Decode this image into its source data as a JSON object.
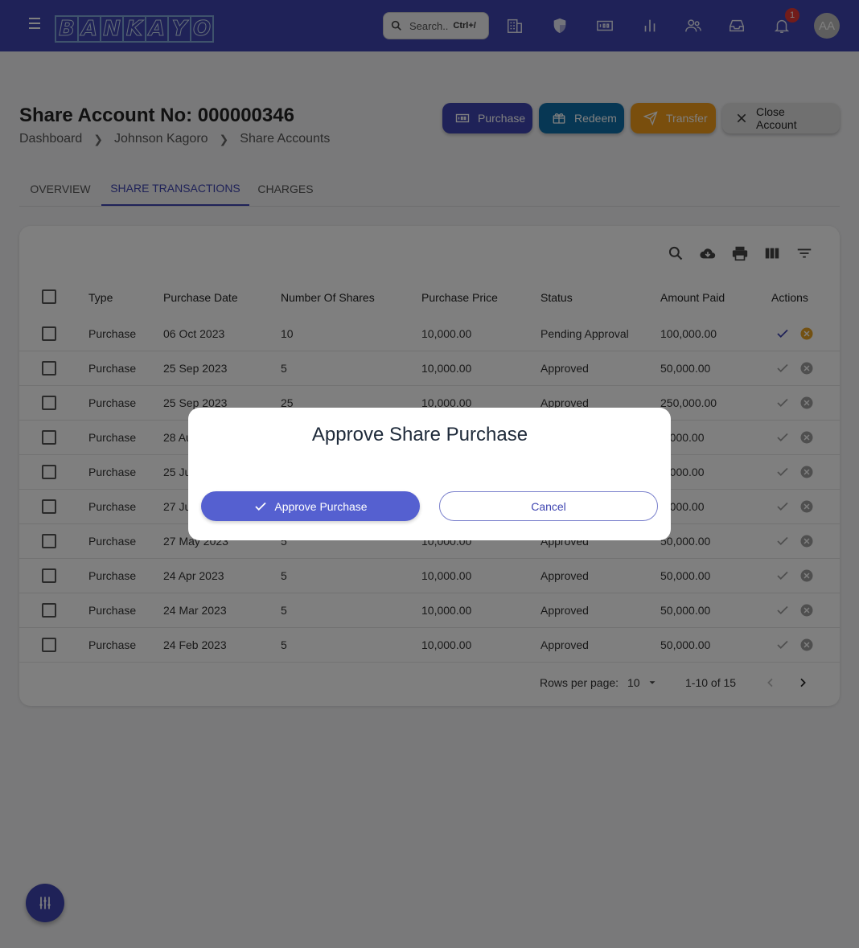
{
  "topbar": {
    "logo_letters": [
      "B",
      "A",
      "N",
      "K",
      "A",
      "Y",
      "O"
    ],
    "search_placeholder": "Search..",
    "search_shortcut": "Ctrl+/",
    "icons": [
      "building-icon",
      "shield-icon",
      "money-icon",
      "bar-chart-icon",
      "users-icon",
      "inbox-icon",
      "bell-icon"
    ],
    "notification_count": "1",
    "avatar_initials": "AA"
  },
  "header": {
    "title": "Share Account No: 000000346",
    "breadcrumb": [
      "Dashboard",
      "Johnson Kagoro",
      "Share Accounts"
    ],
    "actions": {
      "purchase": "Purchase",
      "redeem": "Redeem",
      "transfer": "Transfer",
      "close": "Close Account"
    }
  },
  "tabs": [
    "OVERVIEW",
    "SHARE TRANSACTIONS",
    "CHARGES"
  ],
  "active_tab": "SHARE TRANSACTIONS",
  "table": {
    "columns": [
      "Type",
      "Purchase Date",
      "Number Of Shares",
      "Purchase Price",
      "Status",
      "Amount Paid",
      "Actions"
    ],
    "rows": [
      {
        "type": "Purchase",
        "date": "06 Oct 2023",
        "shares": "10",
        "price": "10,000.00",
        "status": "Pending Approval",
        "amount": "100,000.00",
        "pending": true
      },
      {
        "type": "Purchase",
        "date": "25 Sep 2023",
        "shares": "5",
        "price": "10,000.00",
        "status": "Approved",
        "amount": "50,000.00",
        "pending": false
      },
      {
        "type": "Purchase",
        "date": "25 Sep 2023",
        "shares": "25",
        "price": "10,000.00",
        "status": "Approved",
        "amount": "250,000.00",
        "pending": false
      },
      {
        "type": "Purchase",
        "date": "28 Au",
        "shares": "",
        "price": "",
        "status": "",
        "amount": "0,000.00",
        "pending": false
      },
      {
        "type": "Purchase",
        "date": "25 Ju",
        "shares": "",
        "price": "",
        "status": "",
        "amount": "0,000.00",
        "pending": false
      },
      {
        "type": "Purchase",
        "date": "27 Ju",
        "shares": "",
        "price": "",
        "status": "",
        "amount": "0,000.00",
        "pending": false
      },
      {
        "type": "Purchase",
        "date": "27 May 2023",
        "shares": "5",
        "price": "10,000.00",
        "status": "Approved",
        "amount": "50,000.00",
        "pending": false
      },
      {
        "type": "Purchase",
        "date": "24 Apr 2023",
        "shares": "5",
        "price": "10,000.00",
        "status": "Approved",
        "amount": "50,000.00",
        "pending": false
      },
      {
        "type": "Purchase",
        "date": "24 Mar 2023",
        "shares": "5",
        "price": "10,000.00",
        "status": "Approved",
        "amount": "50,000.00",
        "pending": false
      },
      {
        "type": "Purchase",
        "date": "24 Feb 2023",
        "shares": "5",
        "price": "10,000.00",
        "status": "Approved",
        "amount": "50,000.00",
        "pending": false
      }
    ]
  },
  "pagination": {
    "rows_per_page_label": "Rows per page:",
    "rows_per_page_value": "10",
    "range": "1-10 of 15"
  },
  "dialog": {
    "title": "Approve Share Purchase",
    "approve_label": "Approve Purchase",
    "cancel_label": "Cancel"
  },
  "colors": {
    "primary": "#3f45b1",
    "purchase_btn": "#3f45b1",
    "redeem_btn": "#0f6fa8",
    "transfer_btn": "#f29d1b",
    "close_btn": "#e0e0e0",
    "pending_reject": "#e6a324"
  }
}
